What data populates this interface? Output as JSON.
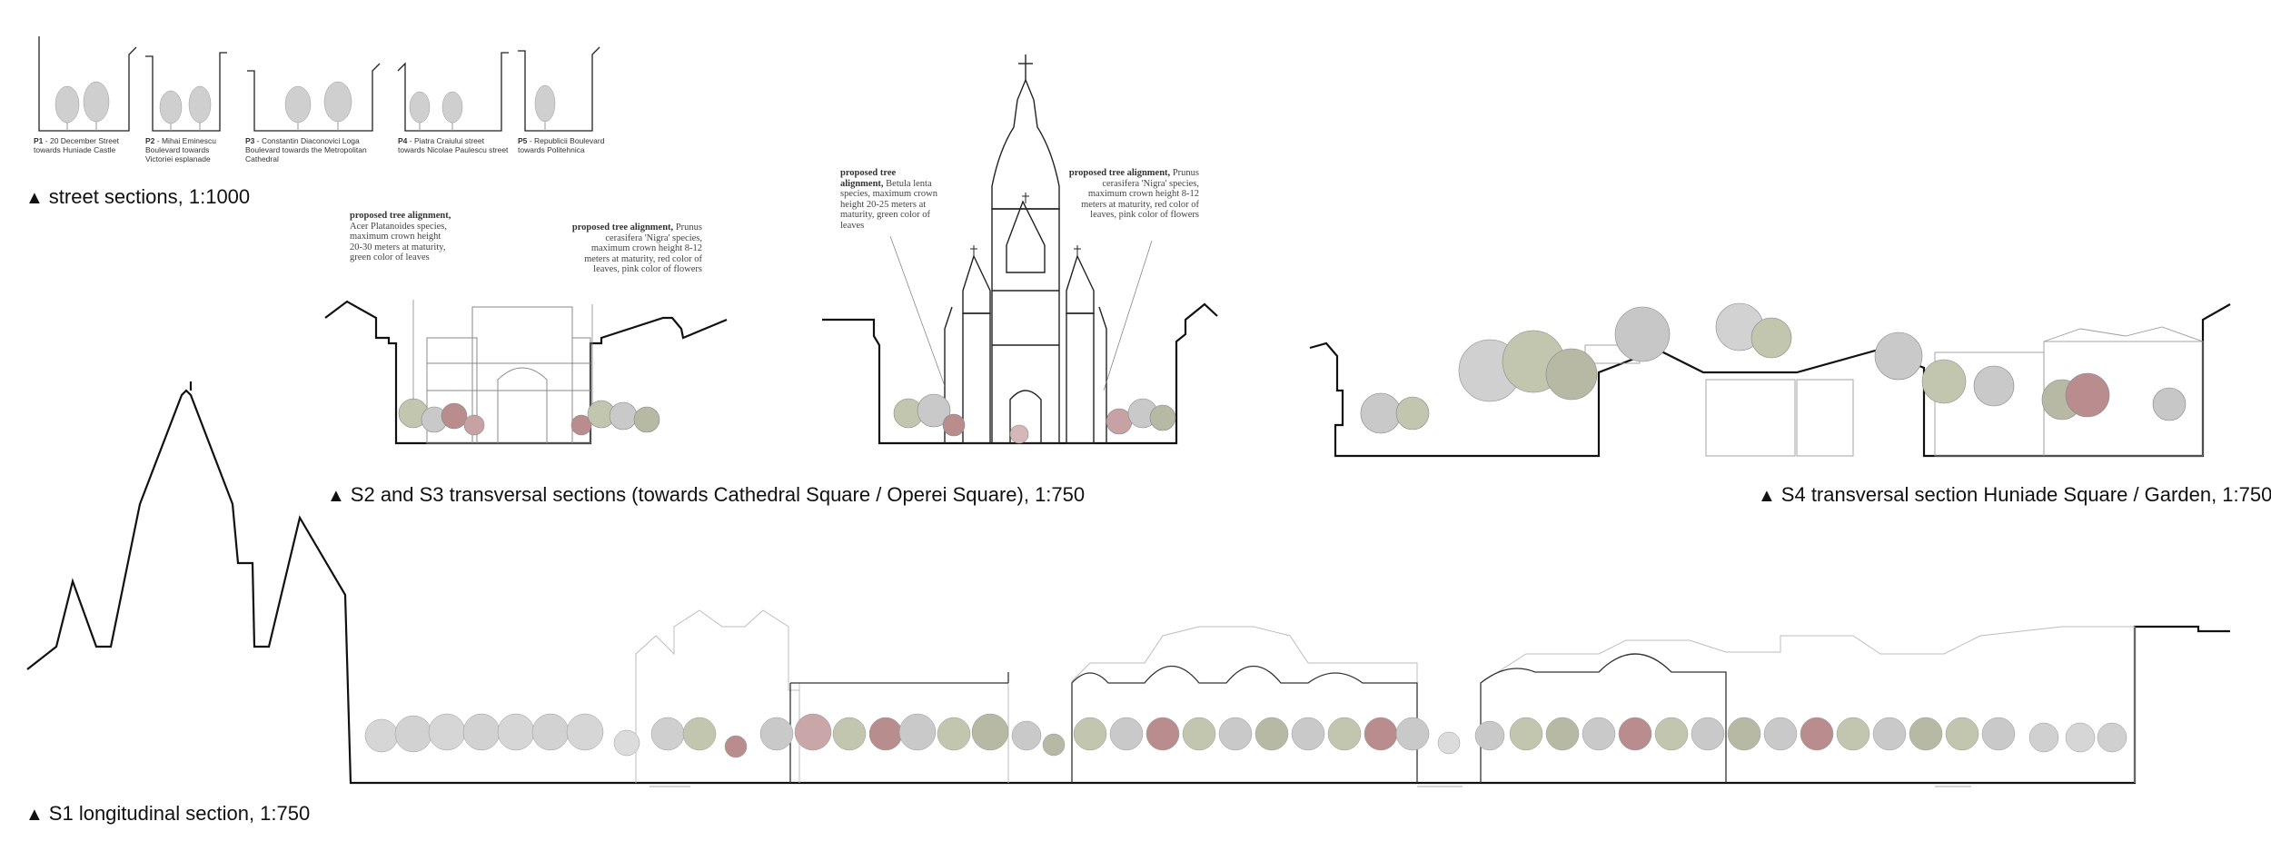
{
  "street_sections": {
    "title": "street sections, 1:1000",
    "items": [
      {
        "code": "P1",
        "text": "- 20 December Street towards Huniade Castle"
      },
      {
        "code": "P2",
        "text": "- Mihai Eminescu Boulevard towards Victoriei esplanade"
      },
      {
        "code": "P3",
        "text": "- Constantin Diaconovici Loga Boulevard towards the Metropolitan Cathedral"
      },
      {
        "code": "P4",
        "text": "- Piatra Craiului street towards Nicolae Paulescu street"
      },
      {
        "code": "P5",
        "text": "- Republicii Boulevard towards Politehnica"
      }
    ]
  },
  "s2_s3": {
    "title": "S2 and S3 transversal sections (towards Cathedral Square / Operei Square), 1:750",
    "notes": [
      {
        "head": "proposed tree alignment,",
        "text": "Acer Platanoides species, maximum crown height 20-30 meters at maturity, green color of leaves"
      },
      {
        "head": "proposed tree alignment,",
        "text": "Prunus cerasifera 'Nigra' species, maximum crown height 8-12 meters at maturity, red color of leaves, pink color of flowers"
      },
      {
        "head": "proposed tree alignment,",
        "text": "Betula lenta species, maximum crown height 20-25 meters at maturity, green color of leaves"
      },
      {
        "head": "proposed tree alignment,",
        "text": "Prunus cerasifera 'Nigra' species, maximum crown height 8-12 meters at maturity, red color of leaves, pink color of flowers"
      }
    ]
  },
  "s4": {
    "title": "S4 transversal section Huniade Square / Garden, 1:750"
  },
  "s1": {
    "title": "S1 longitudinal section, 1:750"
  },
  "colors": {
    "line": "#111111",
    "ghost": "#bdbdbd",
    "tree_grey": "#c9c9c9",
    "tree_green": "#b7b9a4",
    "tree_red": "#b98c8e"
  },
  "marker_glyph": "▲"
}
